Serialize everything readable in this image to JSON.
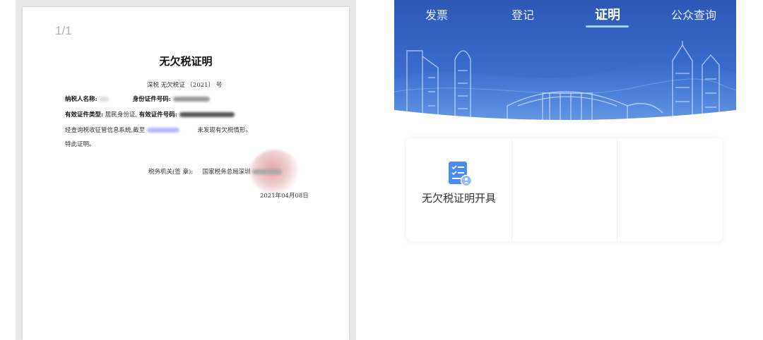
{
  "document": {
    "page_indicator": "1/1",
    "title": "无欠税证明",
    "doc_number": "深税  无欠税证  〔2021〕      号",
    "taxpayer_name_label": "纳税人名称:",
    "id_number_label": "身份证件号码:",
    "id_type_label": "有效证件类型:",
    "id_type_value": "居民身份证,",
    "valid_id_number_label": "有效证件号码:",
    "body_text_start": "经查询税收征管信息系统,截至",
    "body_text_end": "未发现有欠税情形。",
    "certify_text": "特此证明。",
    "authority_label": "税务机关(签 章):",
    "authority_name": "国家税务总局深圳",
    "issue_date": "2021年04月08日"
  },
  "app": {
    "tabs": [
      {
        "label": "发票",
        "active": false
      },
      {
        "label": "登记",
        "active": false
      },
      {
        "label": "证明",
        "active": true
      },
      {
        "label": "公众查询",
        "active": false
      }
    ],
    "services": [
      {
        "label": "无欠税证明开具",
        "icon": "certificate-document-icon"
      },
      {
        "label": "",
        "icon": ""
      },
      {
        "label": "",
        "icon": ""
      }
    ],
    "colors": {
      "banner": "#3a6ccc",
      "active_underline": "#9fd0ff",
      "icon": "#4b8cf0"
    }
  }
}
